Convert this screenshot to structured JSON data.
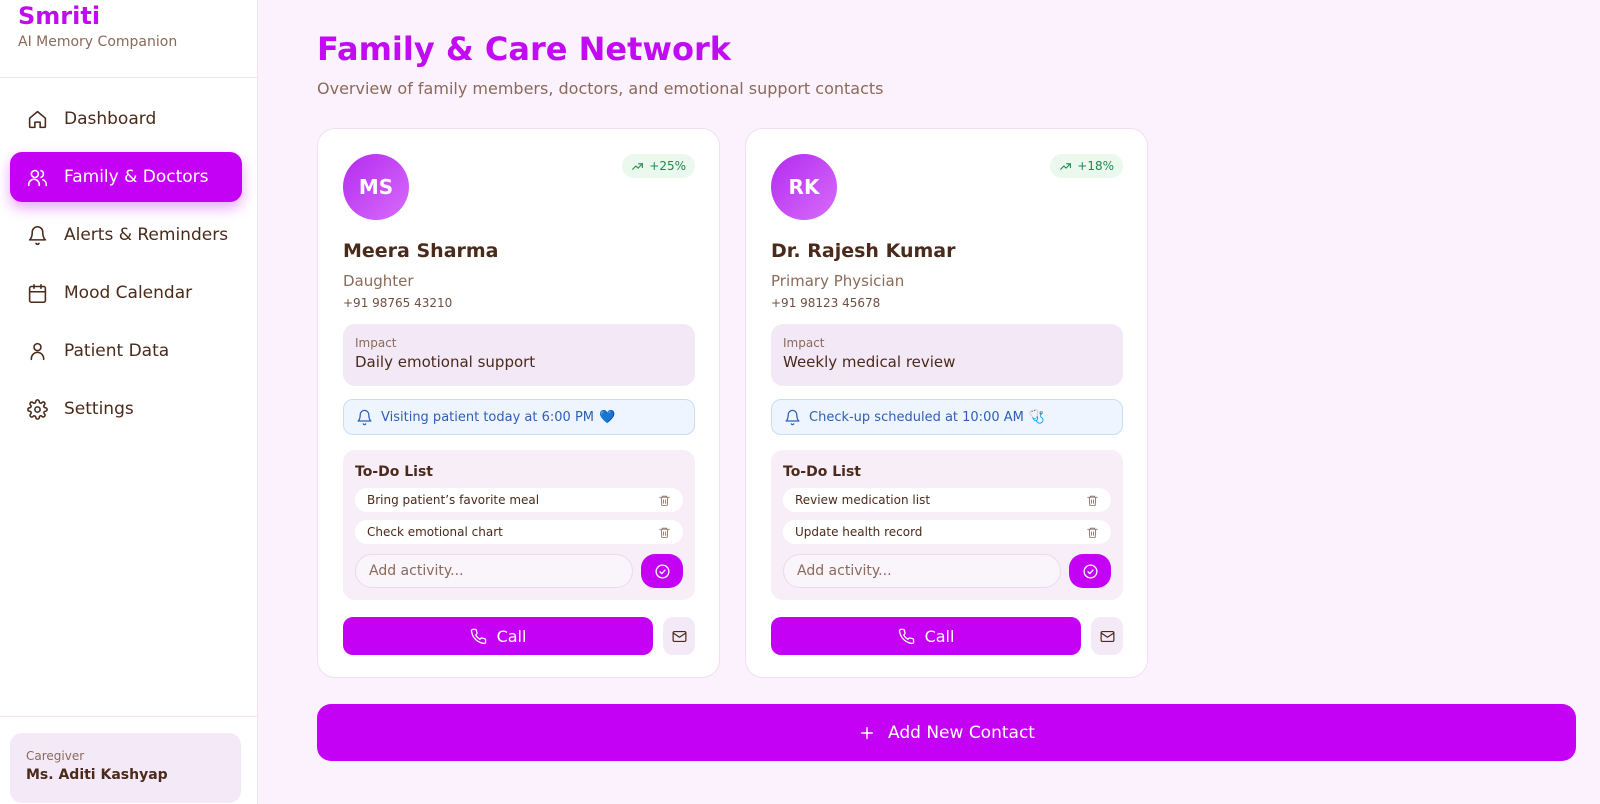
{
  "brand": {
    "name": "Smriti",
    "subtitle": "AI Memory Companion"
  },
  "sidebar": {
    "items": [
      {
        "label": "Dashboard",
        "icon": "home-icon",
        "active": false
      },
      {
        "label": "Family & Doctors",
        "icon": "users-icon",
        "active": true
      },
      {
        "label": "Alerts & Reminders",
        "icon": "bell-icon",
        "active": false
      },
      {
        "label": "Mood Calendar",
        "icon": "calendar-icon",
        "active": false
      },
      {
        "label": "Patient Data",
        "icon": "user-icon",
        "active": false
      },
      {
        "label": "Settings",
        "icon": "gear-icon",
        "active": false
      }
    ],
    "caregiver": {
      "label": "Caregiver",
      "name": "Ms. Aditi Kashyap"
    }
  },
  "page": {
    "title": "Family & Care Network",
    "subtitle": "Overview of family members, doctors, and emotional support contacts"
  },
  "contacts": [
    {
      "initials": "MS",
      "trend": "+25%",
      "name": "Meera Sharma",
      "role": "Daughter",
      "phone": "+91 98765 43210",
      "impact_label": "Impact",
      "impact": "Daily emotional support",
      "notice": "Visiting patient today at 6:00 PM",
      "notice_emoji": "💙",
      "todo_title": "To-Do List",
      "todos": [
        "Bring patient’s favorite meal",
        "Check emotional chart"
      ],
      "add_placeholder": "Add activity...",
      "call_label": "Call"
    },
    {
      "initials": "RK",
      "trend": "+18%",
      "name": "Dr. Rajesh Kumar",
      "role": "Primary Physician",
      "phone": "+91 98123 45678",
      "impact_label": "Impact",
      "impact": "Weekly medical review",
      "notice": "Check-up scheduled at 10:00 AM",
      "notice_emoji": "🩺",
      "todo_title": "To-Do List",
      "todos": [
        "Review medication list",
        "Update health record"
      ],
      "add_placeholder": "Add activity...",
      "call_label": "Call"
    }
  ],
  "add_contact_label": "Add New Contact",
  "colors": {
    "accent": "#c400f5",
    "brand": "#c10bf2",
    "trend_green": "#1f8a4c",
    "notice_blue": "#2d5fb8"
  }
}
